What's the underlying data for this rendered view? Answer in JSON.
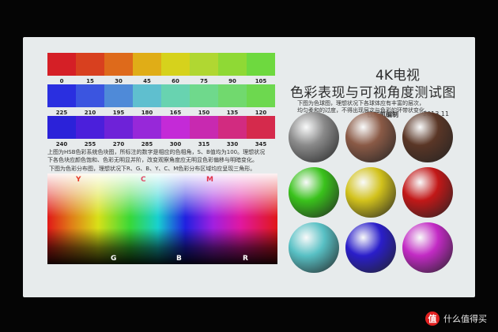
{
  "title": {
    "line1": "4K电视",
    "line2": "色彩表现与可视角度测试图"
  },
  "author": {
    "name": "钱元凯编制",
    "date": "2013.11"
  },
  "hue_rows": [
    {
      "labels": [
        "0",
        "15",
        "30",
        "45",
        "60",
        "75",
        "90",
        "105"
      ],
      "colors": [
        "#d51f26",
        "#d8401f",
        "#de6a1b",
        "#e0ad17",
        "#d6d21c",
        "#b0d732",
        "#8fd935",
        "#6ed93f"
      ]
    },
    {
      "labels": [
        "225",
        "210",
        "195",
        "180",
        "165",
        "150",
        "135",
        "120"
      ],
      "colors": [
        "#2a2fe0",
        "#3b55e0",
        "#4f8ad8",
        "#5fbfcf",
        "#68d3b0",
        "#6fd98c",
        "#71d96e",
        "#6dd84f"
      ]
    },
    {
      "labels": [
        "240",
        "255",
        "270",
        "285",
        "300",
        "315",
        "330",
        "345"
      ],
      "colors": [
        "#2b22d9",
        "#4b1fdb",
        "#6e22d8",
        "#9728d9",
        "#c42ad7",
        "#c829b0",
        "#d22b80",
        "#d52a4c"
      ]
    }
  ],
  "hsb_note": {
    "line1": "上图为HSB色彩系统色块图，所标注的数字是相应的色相角，S、B值均为100。理想状况",
    "line2": "下各色块应颜色饱和、色彩无明显并阶，改变观察角度应无明显色彩偏移与明暗变化。"
  },
  "dist_note": "下图为色彩分布图，理想状况下R、G、B、Y、C、M色彩分布区域均应呈现三角形。",
  "dist_letters": {
    "top": [
      "Y",
      "C",
      "M"
    ],
    "bottom": [
      "G",
      "B",
      "R"
    ],
    "top_colors": [
      "#e53a2a",
      "#e04a6a",
      "#e0334a"
    ]
  },
  "sphere_note": {
    "line1": "下图为色球图，理想状况下各球体应有丰富的层次，",
    "line2": "均匀柔和的过度，不得出现层次与色彩的环带状变化。"
  },
  "spheres": [
    {
      "name": "gray",
      "color": "#8a8a8a"
    },
    {
      "name": "brown",
      "color": "#8a5a46"
    },
    {
      "name": "dark-brown",
      "color": "#5a3626"
    },
    {
      "name": "green",
      "color": "#3ac21c"
    },
    {
      "name": "yellow",
      "color": "#d2c21c"
    },
    {
      "name": "red",
      "color": "#c21818"
    },
    {
      "name": "cyan",
      "color": "#58c0c4"
    },
    {
      "name": "blue",
      "color": "#2a1eca"
    },
    {
      "name": "magenta",
      "color": "#c22ac4"
    }
  ],
  "watermark": {
    "badge": "值",
    "text": "什么值得买"
  }
}
